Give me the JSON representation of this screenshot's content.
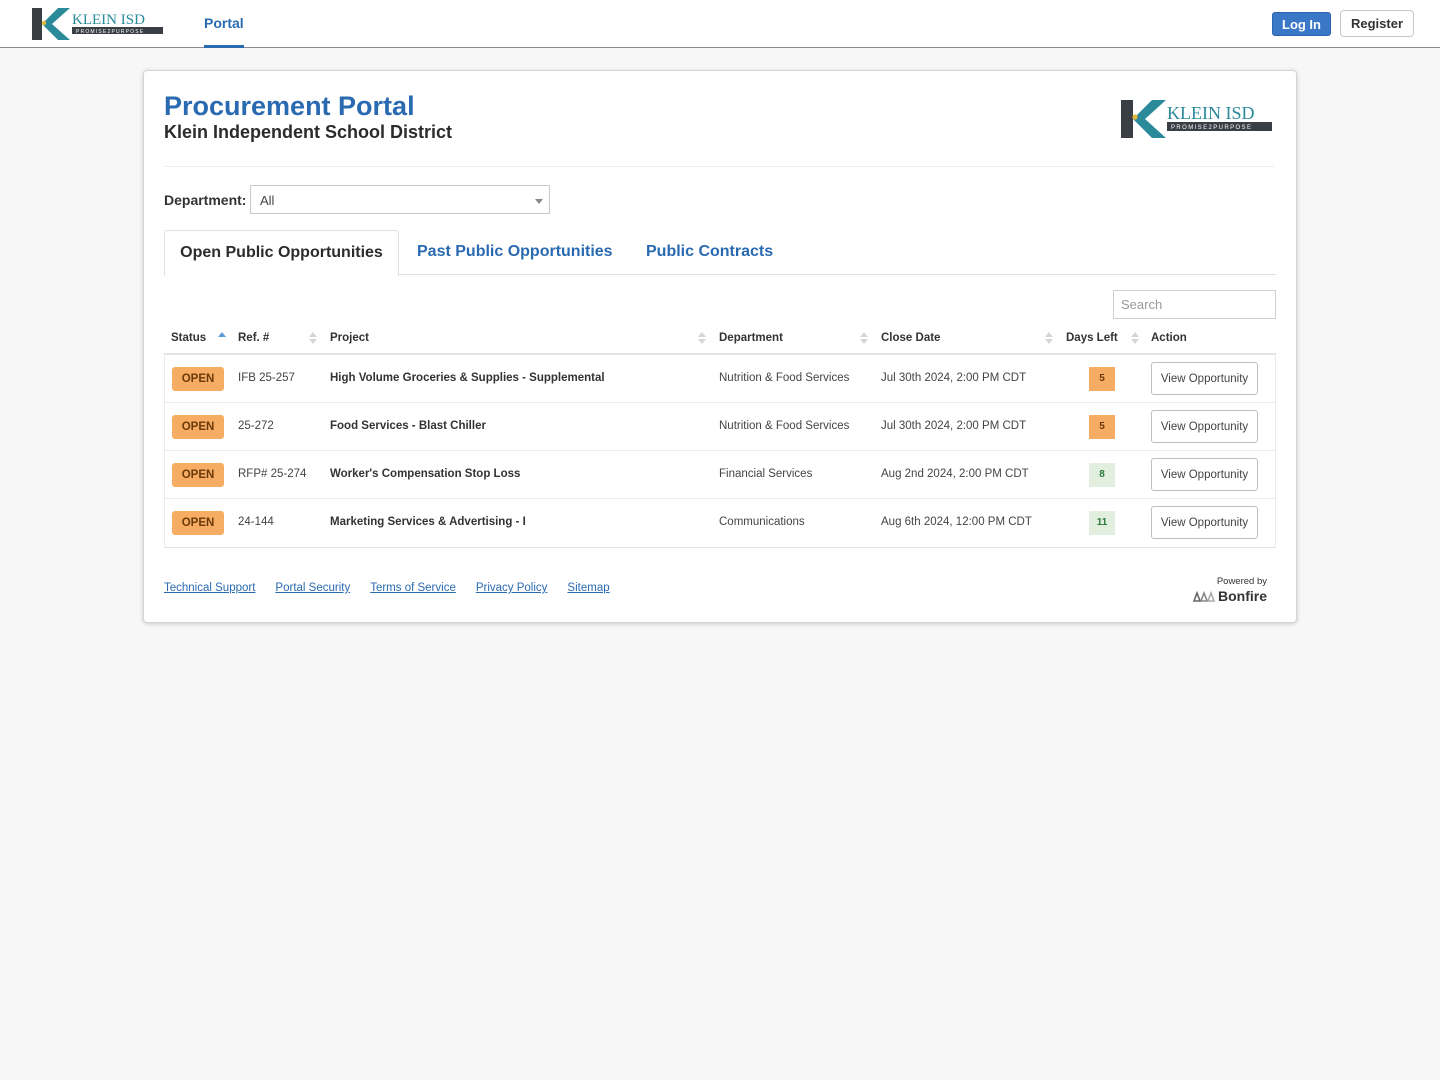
{
  "topbar": {
    "logo_alt": "Klein ISD - Promise2Purpose",
    "logo_name": "KLEIN ISD",
    "logo_tagline": "PROMISE2PURPOSE",
    "nav_portal": "Portal",
    "login_label": "Log In",
    "register_label": "Register"
  },
  "header": {
    "title": "Procurement Portal",
    "subtitle": "Klein Independent School District"
  },
  "filter": {
    "department_label": "Department:",
    "department_value": "All"
  },
  "tabs": [
    {
      "label": "Open Public Opportunities",
      "active": true
    },
    {
      "label": "Past Public Opportunities",
      "active": false
    },
    {
      "label": "Public Contracts",
      "active": false
    }
  ],
  "search": {
    "placeholder": "Search"
  },
  "table": {
    "columns": [
      "Status",
      "Ref. #",
      "Project",
      "Department",
      "Close Date",
      "Days Left",
      "Action"
    ],
    "sorted_column": "Status",
    "sort_direction": "asc",
    "rows": [
      {
        "status": "OPEN",
        "ref": "IFB 25-257",
        "project": "High Volume Groceries & Supplies - Supplemental",
        "department": "Nutrition & Food Services",
        "close_date": "Jul 30th 2024, 2:00 PM CDT",
        "days_left": "5",
        "days_level": "warn",
        "action": "View Opportunity"
      },
      {
        "status": "OPEN",
        "ref": "25-272",
        "project": "Food Services - Blast Chiller",
        "department": "Nutrition & Food Services",
        "close_date": "Jul 30th 2024, 2:00 PM CDT",
        "days_left": "5",
        "days_level": "warn",
        "action": "View Opportunity"
      },
      {
        "status": "OPEN",
        "ref": "RFP# 25-274",
        "project": "Worker's Compensation Stop Loss",
        "department": "Financial Services",
        "close_date": "Aug 2nd 2024, 2:00 PM CDT",
        "days_left": "8",
        "days_level": "ok",
        "action": "View Opportunity"
      },
      {
        "status": "OPEN",
        "ref": "24-144",
        "project": "Marketing Services & Advertising - I",
        "department": "Communications",
        "close_date": "Aug 6th 2024, 12:00 PM CDT",
        "days_left": "11",
        "days_level": "ok",
        "action": "View Opportunity"
      }
    ]
  },
  "footer": {
    "links": [
      "Technical Support",
      "Portal Security",
      "Terms of Service",
      "Privacy Policy",
      "Sitemap"
    ],
    "powered_by": "Powered by",
    "brand": "Bonfire"
  },
  "colors": {
    "brand_blue": "#2a6ab1",
    "login_blue": "#3b77c7",
    "open_badge": "#f6ad63",
    "days_ok_bg": "#e2efde",
    "days_ok_text": "#2b7a3a",
    "logo_teal": "#2a8a9a"
  }
}
